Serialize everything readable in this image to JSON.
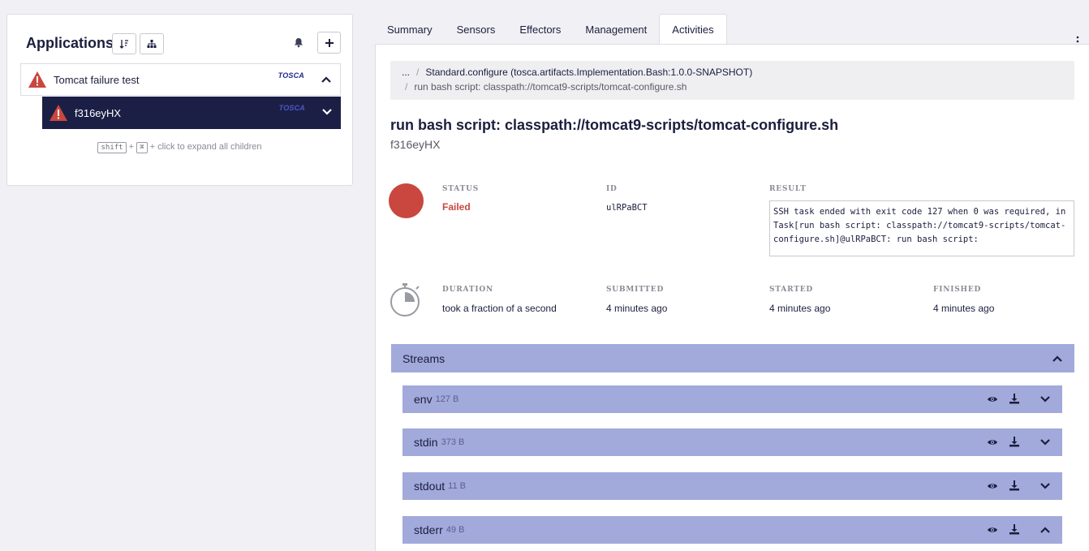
{
  "left": {
    "title": "Applications",
    "tree": [
      {
        "label": "Tomcat failure test",
        "badge": "TOSCA",
        "expanded": true
      },
      {
        "label": "f316eyHX",
        "badge": "TOSCA",
        "expanded": false,
        "selected": true
      }
    ],
    "hint": {
      "key1": "shift",
      "plus": "+",
      "key2": "⌘",
      "text": "+ click to expand all children"
    }
  },
  "tabs": [
    "Summary",
    "Sensors",
    "Effectors",
    "Management",
    "Activities"
  ],
  "active_tab": "Activities",
  "breadcrumb": {
    "ellipsis": "...",
    "sep": "/",
    "item1": "Standard.configure (tosca.artifacts.Implementation.Bash:1.0.0-SNAPSHOT)",
    "item2": "run bash script: classpath://tomcat9-scripts/tomcat-configure.sh"
  },
  "task": {
    "title": "run bash script: classpath://tomcat9-scripts/tomcat-configure.sh",
    "entity": "f316eyHX",
    "status_label": "STATUS",
    "status": "Failed",
    "id_label": "ID",
    "id": "ulRPaBCT",
    "result_label": "RESULT",
    "result": "SSH task ended with exit code 127 when 0 was required, in Task[run bash script: classpath://tomcat9-scripts/tomcat-configure.sh]@ulRPaBCT: run bash script:",
    "duration_label": "DURATION",
    "duration": "took a fraction of a second",
    "submitted_label": "SUBMITTED",
    "submitted": "4 minutes ago",
    "started_label": "STARTED",
    "started": "4 minutes ago",
    "finished_label": "FINISHED",
    "finished": "4 minutes ago"
  },
  "streams": {
    "title": "Streams",
    "items": [
      {
        "name": "env",
        "size": "127 B",
        "expanded": false
      },
      {
        "name": "stdin",
        "size": "373 B",
        "expanded": false
      },
      {
        "name": "stdout",
        "size": "11 B",
        "expanded": false
      },
      {
        "name": "stderr",
        "size": "49 B",
        "expanded": true
      }
    ]
  },
  "colors": {
    "navy": "#1c1f45",
    "failed": "#c9473e",
    "stream_bg": "#a2a9db"
  }
}
